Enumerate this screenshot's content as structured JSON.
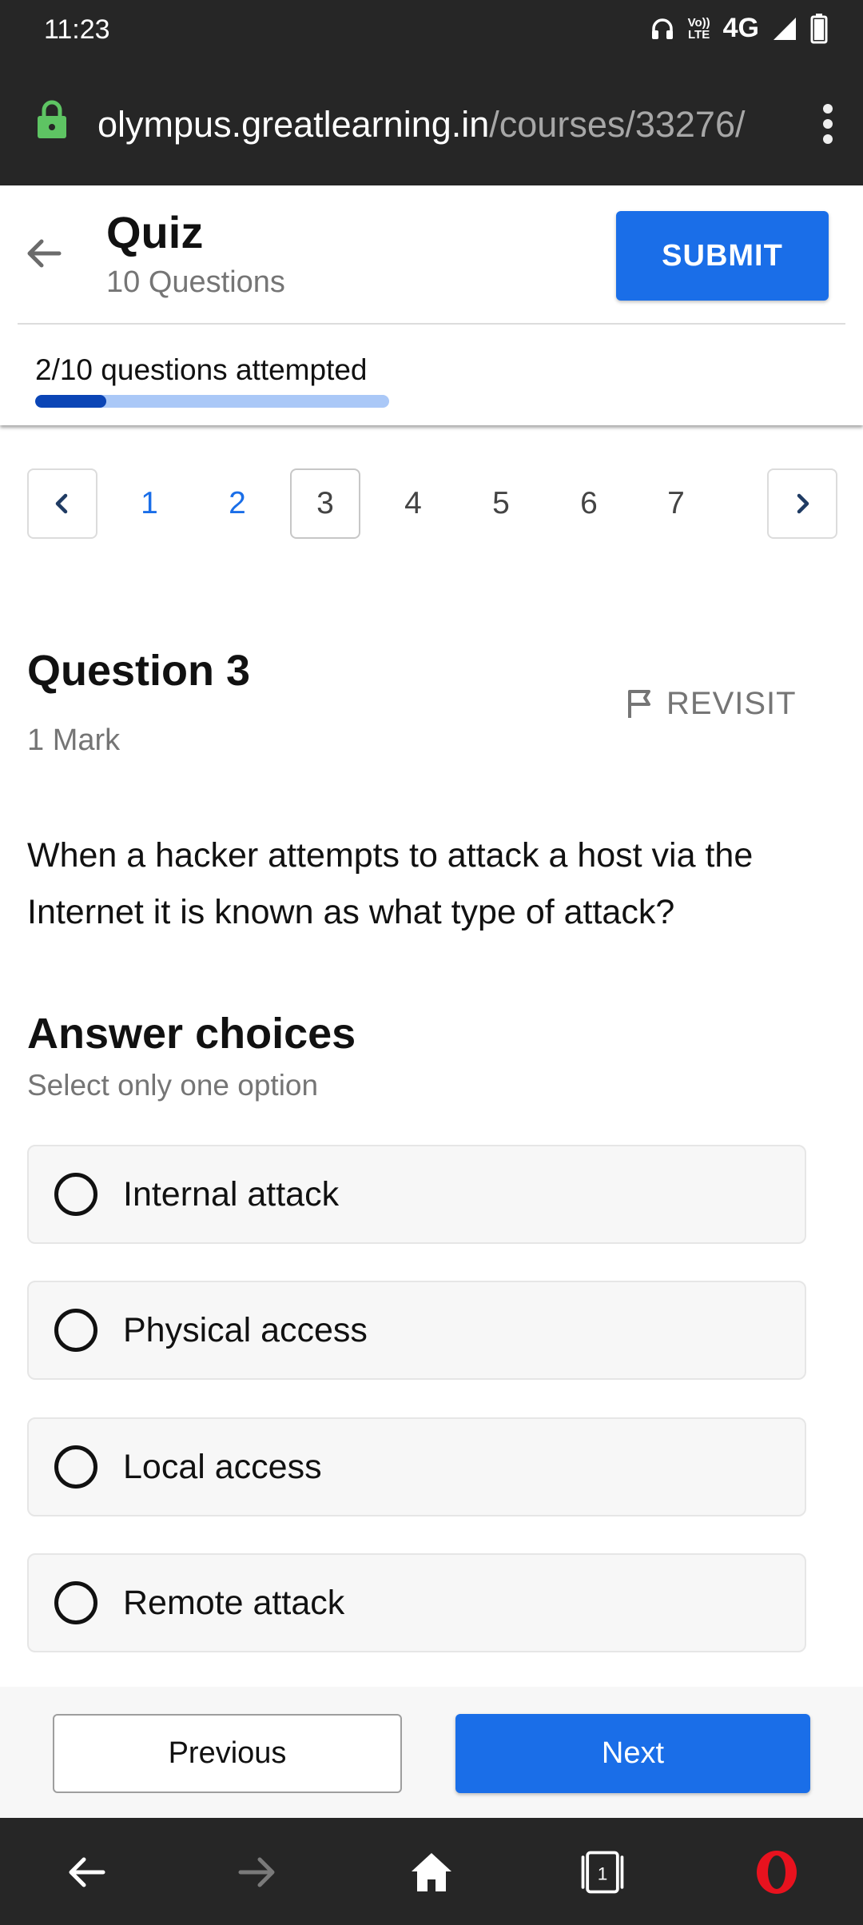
{
  "status_bar": {
    "time": "11:23",
    "network": "4G",
    "volte_top": "Vo))",
    "volte_bottom": "LTE",
    "icons": [
      "headphones-icon",
      "volte-icon",
      "signal-icon",
      "battery-icon"
    ]
  },
  "browser": {
    "url_host": "olympus.greatlearning.in",
    "url_path": "/courses/33276/",
    "lock_color": "#5ec463"
  },
  "header": {
    "title": "Quiz",
    "subtitle": "10 Questions",
    "submit_label": "SUBMIT",
    "progress_text": "2/10 questions attempted",
    "progress_fraction": 0.2,
    "accent_color": "#1a6ee8"
  },
  "pager": {
    "pages": [
      "1",
      "2",
      "3",
      "4",
      "5",
      "6",
      "7"
    ],
    "visited": [
      "1",
      "2"
    ],
    "current": "3"
  },
  "question": {
    "title": "Question 3",
    "marks": "1 Mark",
    "revisit_label": "REVISIT",
    "text": "When a hacker attempts to attack a host via the Internet it is known as what type of attack?"
  },
  "answers": {
    "title": "Answer choices",
    "hint": "Select only one option",
    "options": [
      "Internal attack",
      "Physical access",
      "Local access",
      "Remote attack"
    ]
  },
  "footer": {
    "previous_label": "Previous",
    "next_label": "Next"
  },
  "bottom_nav": {
    "tab_count": "1",
    "icons": [
      "back-icon",
      "forward-icon",
      "home-icon",
      "tabs-icon",
      "opera-icon"
    ]
  }
}
